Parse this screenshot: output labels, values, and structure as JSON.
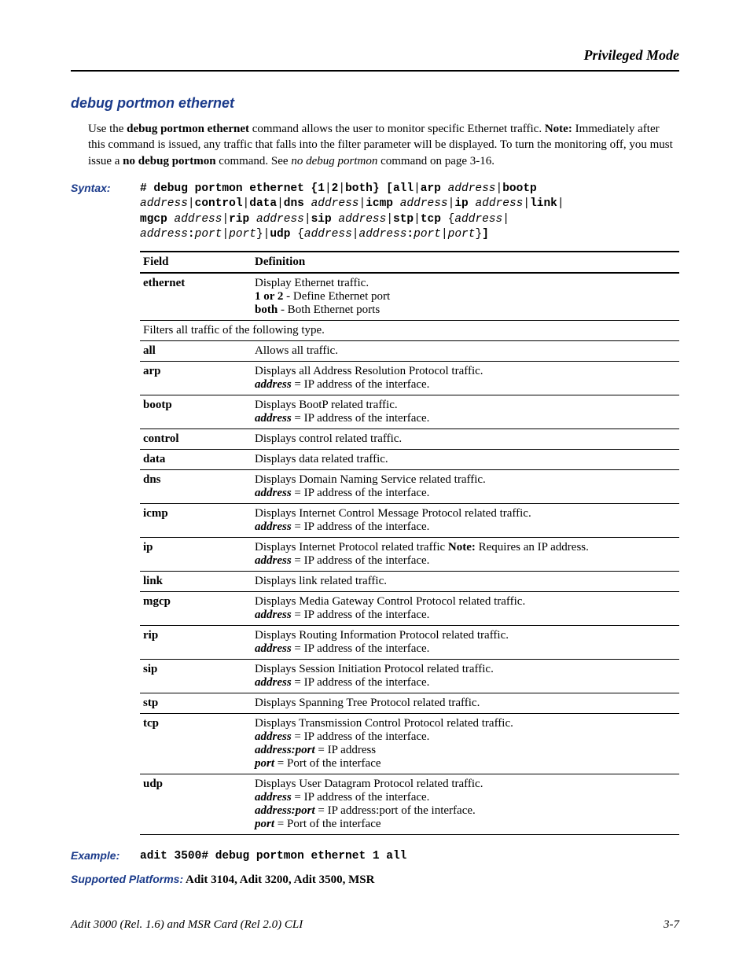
{
  "runningHead": "Privileged Mode",
  "sectionTitle": "debug portmon ethernet",
  "intro": {
    "prefix": "Use the ",
    "command": "debug portmon ethernet",
    "after": " command allows the user to monitor specific Ethernet traffic. ",
    "noteLabel": "Note:",
    "noteText1": " Immediately after this command is issued, any traffic that falls into the filter parameter will be displayed. To turn the monitoring off, you must issue a ",
    "noDebug": "no debug portmon",
    "noteText2": " command. See ",
    "noDebugItalic": "no debug portmon",
    "noteText3": " command on page 3-16."
  },
  "labels": {
    "syntax": "Syntax:",
    "example": "Example:",
    "platforms": "Supported Platforms:"
  },
  "syntax": {
    "line1": {
      "p1": "# debug portmon ethernet {1",
      "p2": "2",
      "p3": "both} [all",
      "p4": "arp",
      "a1": "address",
      "p5": "bootp"
    },
    "line2": {
      "a1": "address",
      "p1": "control",
      "p2": "data",
      "p3": "dns",
      "a2": "address",
      "p4": "icmp",
      "a3": "address",
      "p5": "ip",
      "a4": "address",
      "p6": "link"
    },
    "line3": {
      "p1": "mgcp",
      "a1": "address",
      "p2": "rip",
      "a2": "address",
      "p3": "sip",
      "a3": "address",
      "p4": "stp",
      "p5": "tcp",
      "a4": "address"
    },
    "line4": {
      "a1": "address",
      "p1": ":",
      "a2": "port",
      "a3": "port",
      "p2": "udp",
      "a4": "address",
      "a5": "address",
      "p3": ":",
      "a6": "port",
      "a7": "port",
      "p4": "}"
    }
  },
  "tableHead": {
    "field": "Field",
    "definition": "Definition"
  },
  "rowEthernet": {
    "field": "ethernet",
    "l1": "Display Ethernet traffic.",
    "l2a": "1 or 2",
    "l2b": " - Define Ethernet port",
    "l3a": "both",
    "l3b": " - Both Ethernet ports"
  },
  "filterRow": "Filters all traffic of the following type.",
  "rows": [
    {
      "field": "all",
      "plain": "Allows all traffic."
    },
    {
      "field": "arp",
      "l1": "Displays all Address Resolution Protocol traffic.",
      "addr": "address",
      "addrDef": " = IP address of the interface."
    },
    {
      "field": "bootp",
      "l1": "Displays BootP related traffic.",
      "addr": "address",
      "addrDef": " = IP address of the interface."
    },
    {
      "field": "control",
      "plain": "Displays control related traffic."
    },
    {
      "field": "data",
      "plain": "Displays data related traffic."
    },
    {
      "field": "dns",
      "l1": "Displays Domain Naming Service related traffic.",
      "addr": "address",
      "addrDef": " = IP address of the interface."
    },
    {
      "field": "icmp",
      "l1": "Displays Internet Control Message Protocol related traffic.",
      "addr": "address",
      "addrDef": " = IP address of the interface."
    },
    {
      "field": "ip",
      "l1a": "Displays Internet Protocol related traffic ",
      "noteLbl": "Note:",
      "l1b": " Requires an IP address.",
      "addr": "address",
      "addrDef": " = IP address of the interface."
    },
    {
      "field": "link",
      "plain": "Displays link related traffic."
    },
    {
      "field": "mgcp",
      "l1": "Displays Media Gateway Control Protocol related traffic.",
      "addr": "address",
      "addrDef": " = IP address of the interface."
    },
    {
      "field": "rip",
      "l1": "Displays Routing Information Protocol related traffic.",
      "addr": "address",
      "addrDef": " = IP address of the interface."
    },
    {
      "field": "sip",
      "l1": "Displays Session Initiation Protocol related traffic.",
      "addr": "address",
      "addrDef": " = IP address of the interface."
    },
    {
      "field": "stp",
      "plain": "Displays Spanning Tree Protocol related traffic."
    }
  ],
  "rowTcp": {
    "field": "tcp",
    "l1": "Displays Transmission Control Protocol related traffic.",
    "addr": "address",
    "addrDef": " = IP address of the interface.",
    "ap": "address:port",
    "apDef": " = IP address",
    "port": "port",
    "portDef": " = Port of the interface"
  },
  "rowUdp": {
    "field": "udp",
    "l1": "Displays User Datagram Protocol related traffic.",
    "addr": "address",
    "addrDef": " = IP address of the interface.",
    "ap": "address:port",
    "apDef": " = IP address:port of the interface.",
    "port": "port",
    "portDef": " = Port of the interface"
  },
  "example": "adit 3500# debug portmon ethernet 1 all",
  "platforms": "  Adit 3104, Adit 3200, Adit 3500, MSR",
  "footer": {
    "left": "Adit 3000 (Rel. 1.6) and MSR Card (Rel 2.0) CLI",
    "right": "3-7"
  }
}
